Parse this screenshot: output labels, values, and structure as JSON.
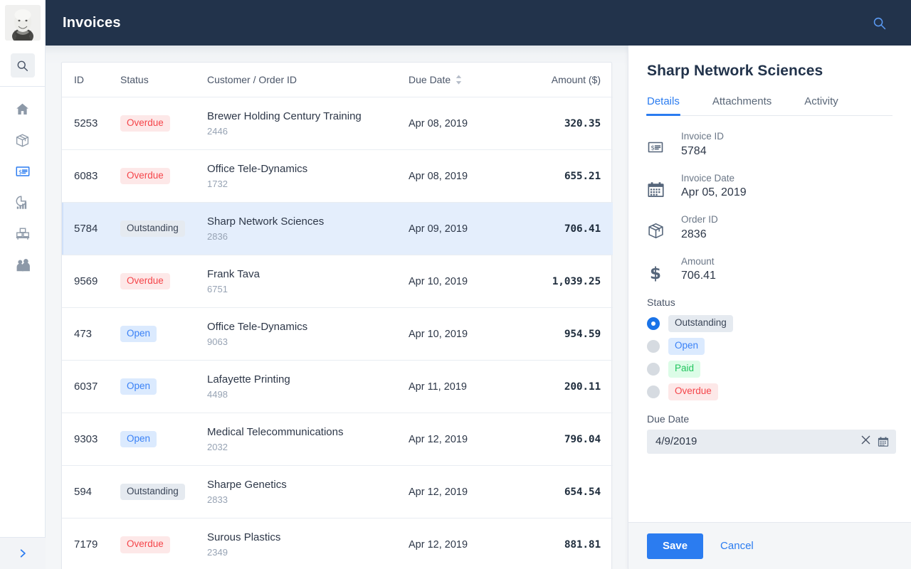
{
  "app": {
    "header": {
      "title": "Invoices",
      "search_icon": "search-icon"
    },
    "avatar_alt": "user-avatar"
  },
  "rail": {
    "search_icon": "search-icon",
    "expand_icon": "chevron-right-icon",
    "items": [
      {
        "name": "home",
        "icon": "home-icon",
        "active": false
      },
      {
        "name": "products",
        "icon": "box-icon",
        "active": false
      },
      {
        "name": "invoices",
        "icon": "invoice-icon",
        "active": true
      },
      {
        "name": "analytics",
        "icon": "pie-bar-chart-icon",
        "active": false
      },
      {
        "name": "inventory",
        "icon": "pallet-icon",
        "active": false
      },
      {
        "name": "customers",
        "icon": "people-icon",
        "active": false
      }
    ]
  },
  "table": {
    "columns": {
      "id": "ID",
      "status": "Status",
      "customer": "Customer / Order ID",
      "due_date": "Due Date",
      "amount": "Amount ($)"
    },
    "sort_icon": "sort-arrows-icon",
    "rows": [
      {
        "id": "5253",
        "status": "Overdue",
        "status_key": "overdue",
        "customer": "Brewer Holding Century Training",
        "order_id": "2446",
        "due_date": "Apr 08, 2019",
        "amount": "320.35",
        "selected": false
      },
      {
        "id": "6083",
        "status": "Overdue",
        "status_key": "overdue",
        "customer": "Office Tele-Dynamics",
        "order_id": "1732",
        "due_date": "Apr 08, 2019",
        "amount": "655.21",
        "selected": false
      },
      {
        "id": "5784",
        "status": "Outstanding",
        "status_key": "outstanding",
        "customer": "Sharp Network Sciences",
        "order_id": "2836",
        "due_date": "Apr 09, 2019",
        "amount": "706.41",
        "selected": true
      },
      {
        "id": "9569",
        "status": "Overdue",
        "status_key": "overdue",
        "customer": "Frank Tava",
        "order_id": "6751",
        "due_date": "Apr 10, 2019",
        "amount": "1,039.25",
        "selected": false
      },
      {
        "id": "473",
        "status": "Open",
        "status_key": "open",
        "customer": "Office Tele-Dynamics",
        "order_id": "9063",
        "due_date": "Apr 10, 2019",
        "amount": "954.59",
        "selected": false
      },
      {
        "id": "6037",
        "status": "Open",
        "status_key": "open",
        "customer": "Lafayette Printing",
        "order_id": "4498",
        "due_date": "Apr 11, 2019",
        "amount": "200.11",
        "selected": false
      },
      {
        "id": "9303",
        "status": "Open",
        "status_key": "open",
        "customer": "Medical Telecommunications",
        "order_id": "2032",
        "due_date": "Apr 12, 2019",
        "amount": "796.04",
        "selected": false
      },
      {
        "id": "594",
        "status": "Outstanding",
        "status_key": "outstanding",
        "customer": "Sharpe Genetics",
        "order_id": "2833",
        "due_date": "Apr 12, 2019",
        "amount": "654.54",
        "selected": false
      },
      {
        "id": "7179",
        "status": "Overdue",
        "status_key": "overdue",
        "customer": "Surous Plastics",
        "order_id": "2349",
        "due_date": "Apr 12, 2019",
        "amount": "881.81",
        "selected": false
      }
    ]
  },
  "detail": {
    "title": "Sharp Network Sciences",
    "tabs": [
      {
        "label": "Details",
        "active": true
      },
      {
        "label": "Attachments",
        "active": false
      },
      {
        "label": "Activity",
        "active": false
      }
    ],
    "fields": [
      {
        "icon": "invoice-icon",
        "label": "Invoice ID",
        "value": "5784"
      },
      {
        "icon": "calendar-icon",
        "label": "Invoice Date",
        "value": "Apr 05, 2019"
      },
      {
        "icon": "box-icon",
        "label": "Order ID",
        "value": "2836"
      },
      {
        "icon": "dollar-icon",
        "label": "Amount",
        "value": "706.41"
      }
    ],
    "status": {
      "label": "Status",
      "options": [
        {
          "label": "Outstanding",
          "key": "outstanding",
          "selected": true
        },
        {
          "label": "Open",
          "key": "open",
          "selected": false
        },
        {
          "label": "Paid",
          "key": "paid",
          "selected": false
        },
        {
          "label": "Overdue",
          "key": "overdue",
          "selected": false
        }
      ]
    },
    "due_date": {
      "label": "Due Date",
      "value": "4/9/2019",
      "clear_icon": "close-icon",
      "calendar_icon": "calendar-icon"
    },
    "actions": {
      "save": "Save",
      "cancel": "Cancel"
    }
  },
  "colors": {
    "header_bg": "#22334b",
    "accent": "#2b7cf0",
    "overdue": "#f5454a",
    "open": "#3b82f6",
    "paid": "#22c55e",
    "outstanding": "#3b4658",
    "selected_row": "#e4eefc"
  }
}
